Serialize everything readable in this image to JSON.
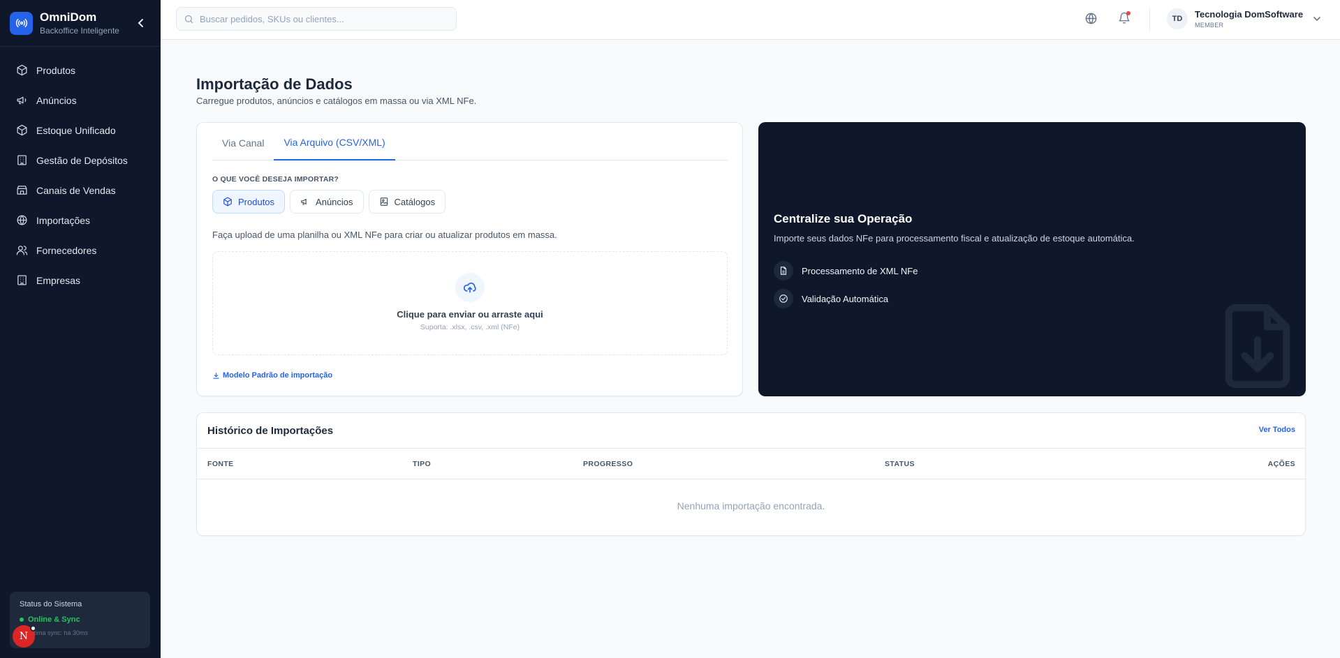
{
  "brand": {
    "name": "OmniDom",
    "subtitle": "Backoffice Inteligente"
  },
  "sidebar": {
    "items": [
      {
        "label": "Produtos",
        "icon": "box-icon"
      },
      {
        "label": "Anúncios",
        "icon": "megaphone-icon"
      },
      {
        "label": "Estoque Unificado",
        "icon": "box-icon"
      },
      {
        "label": "Gestão de Depósitos",
        "icon": "building-icon"
      },
      {
        "label": "Canais de Vendas",
        "icon": "store-icon"
      },
      {
        "label": "Importações",
        "icon": "globe-icon"
      },
      {
        "label": "Fornecedores",
        "icon": "users-icon"
      },
      {
        "label": "Empresas",
        "icon": "building-icon"
      }
    ],
    "status": {
      "title": "Status do Sistema",
      "state": "Online & Sync",
      "last_sync": "Última sync: há 30ms"
    },
    "user_initial": "N"
  },
  "topbar": {
    "search_placeholder": "Buscar pedidos, SKUs ou clientes...",
    "user": {
      "initials": "TD",
      "name": "Tecnologia DomSoftware",
      "role": "MEMBER"
    }
  },
  "page": {
    "title": "Importação de Dados",
    "subtitle": "Carregue produtos, anúncios e catálogos em massa ou via XML NFe."
  },
  "import_card": {
    "tabs": [
      {
        "label": "Via Canal"
      },
      {
        "label": "Via Arquivo (CSV/XML)"
      }
    ],
    "active_tab": 1,
    "section_label": "O QUE VOCÊ DESEJA IMPORTAR?",
    "types": [
      {
        "label": "Produtos"
      },
      {
        "label": "Anúncios"
      },
      {
        "label": "Catálogos"
      }
    ],
    "description": "Faça upload de uma planilha ou XML NFe para criar ou atualizar produtos em massa.",
    "dropzone": {
      "title": "Clique para enviar ou arraste aqui",
      "subtitle": "Suporta: .xlsx, .csv, .xml (NFe)"
    },
    "template_link": "Modelo Padrão de importação"
  },
  "promo": {
    "title": "Centralize sua Operação",
    "description": "Importe seus dados NFe para processamento fiscal e atualização de estoque automática.",
    "features": [
      {
        "label": "Processamento de XML NFe"
      },
      {
        "label": "Validação Automática"
      }
    ]
  },
  "history": {
    "title": "Histórico de Importações",
    "view_all": "Ver Todos",
    "columns": [
      "FONTE",
      "TIPO",
      "PROGRESSO",
      "STATUS",
      "AÇÕES"
    ],
    "empty": "Nenhuma importação encontrada."
  },
  "colors": {
    "sidebar": "#0f172a",
    "accent": "#2563eb",
    "online": "#22c55e",
    "notification": "#ef4444"
  }
}
